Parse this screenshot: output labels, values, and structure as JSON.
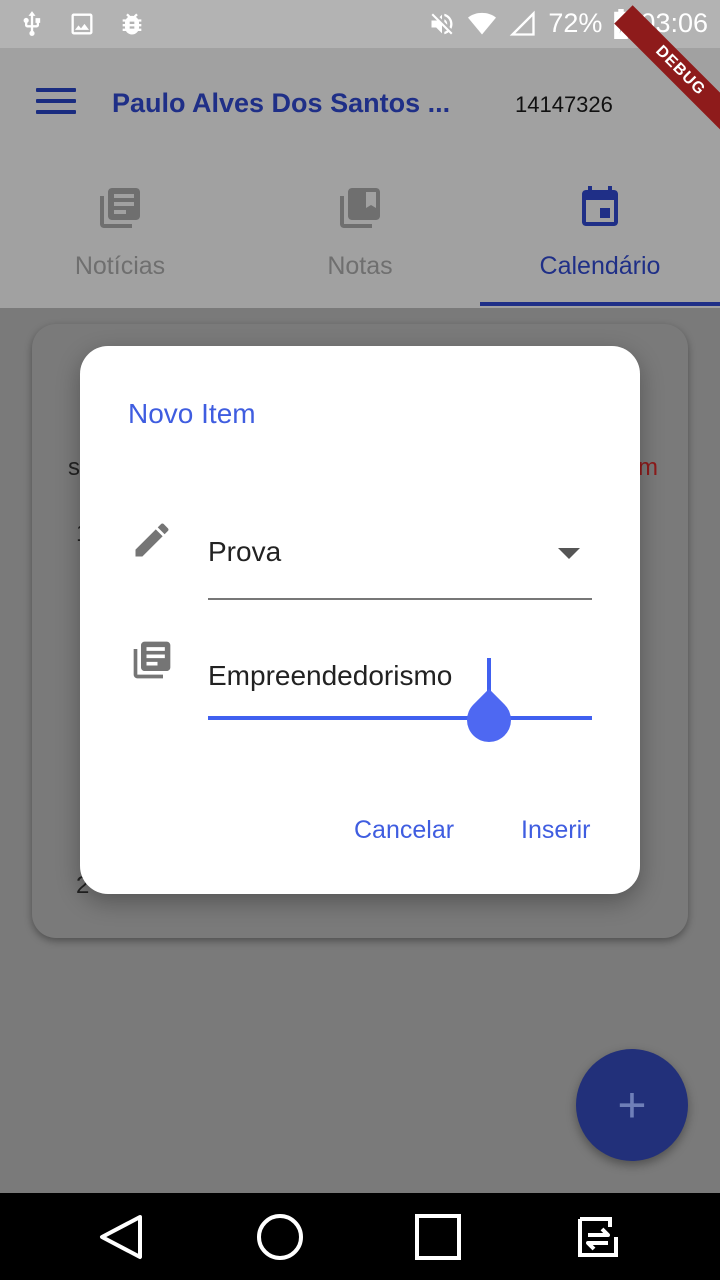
{
  "status_bar": {
    "battery": "72%",
    "time": "03:06"
  },
  "app_bar": {
    "title": "Paulo Alves Dos Santos ...",
    "id": "14147326",
    "debug_banner": "DEBUG"
  },
  "tabs": [
    {
      "label": "Notícias",
      "icon": "newspaper-icon",
      "active": false
    },
    {
      "label": "Notas",
      "icon": "bookmark-library-icon",
      "active": false
    },
    {
      "label": "Calendário",
      "icon": "calendar-icon",
      "active": true
    }
  ],
  "calendar_peek": {
    "weekday_start": "s",
    "weekday_end": "m",
    "row1": "1",
    "row4": "2"
  },
  "dialog": {
    "title": "Novo Item",
    "type_field": {
      "value": "Prova",
      "icon": "pencil-icon"
    },
    "name_field": {
      "value": "Empreendedorismo",
      "icon": "list-library-icon"
    },
    "cancel_label": "Cancelar",
    "submit_label": "Inserir"
  },
  "fab": {
    "icon": "plus-icon",
    "label": "+"
  },
  "colors": {
    "primary": "#1f2f87",
    "accent": "#3f5de0",
    "debug": "#8e1b1b"
  }
}
